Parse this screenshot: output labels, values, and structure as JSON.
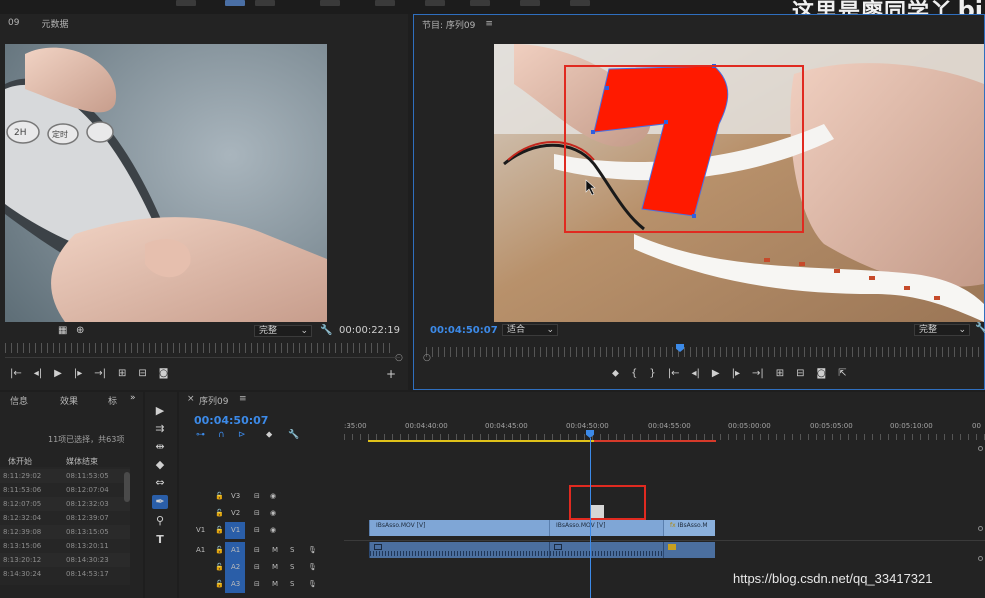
{
  "watermark": {
    "text": "这里是廖同学丫",
    "logo": "bi"
  },
  "source_panel": {
    "tab_index": "09",
    "tab_label": "元数据",
    "dropdown": "完整",
    "timecode": "00:00:22:19"
  },
  "program_panel": {
    "title": "节目: 序列09",
    "timecode": "00:04:50:07",
    "fit": "适合",
    "dropdown": "完整"
  },
  "project_panel": {
    "tabs": [
      "信息",
      "效果",
      "标"
    ],
    "more": "»",
    "selection_info": "11项已选择，共63项",
    "columns": [
      "体开始",
      "媒体结束"
    ],
    "rows": [
      [
        "8:11:29:02",
        "08:11:53:05"
      ],
      [
        "8:11:53:06",
        "08:12:07:04"
      ],
      [
        "8:12:07:05",
        "08:12:32:03"
      ],
      [
        "8:12:32:04",
        "08:12:39:07"
      ],
      [
        "8:12:39:08",
        "08:13:15:05"
      ],
      [
        "8:13:15:06",
        "08:13:20:11"
      ],
      [
        "8:13:20:12",
        "08:14:30:23"
      ],
      [
        "8:14:30:24",
        "08:14:53:17"
      ]
    ]
  },
  "timeline": {
    "tab_close": "×",
    "sequence_name": "序列09",
    "timecode": "00:04:50:07",
    "ruler_labels": [
      ":35:00",
      "00:04:40:00",
      "00:04:45:00",
      "00:04:50:00",
      "00:04:55:00",
      "00:05:00:00",
      "00:05:05:00",
      "00:05:10:00",
      "00"
    ],
    "tracks": [
      {
        "name": "V3",
        "type": "video"
      },
      {
        "name": "V2",
        "type": "video"
      },
      {
        "name": "V1",
        "type": "video",
        "src": "V1"
      },
      {
        "name": "A1",
        "type": "audio",
        "src": "A1"
      },
      {
        "name": "A2",
        "type": "audio"
      },
      {
        "name": "A3",
        "type": "audio"
      }
    ],
    "clips": [
      "IBsAsso.MOV [V]",
      "IBsAsso.MOV [V]",
      "IBsAsso.M"
    ],
    "fx": "fx",
    "mute": "M",
    "solo": "S"
  },
  "footer_watermark": "https://blog.csdn.net/qq_33417321"
}
